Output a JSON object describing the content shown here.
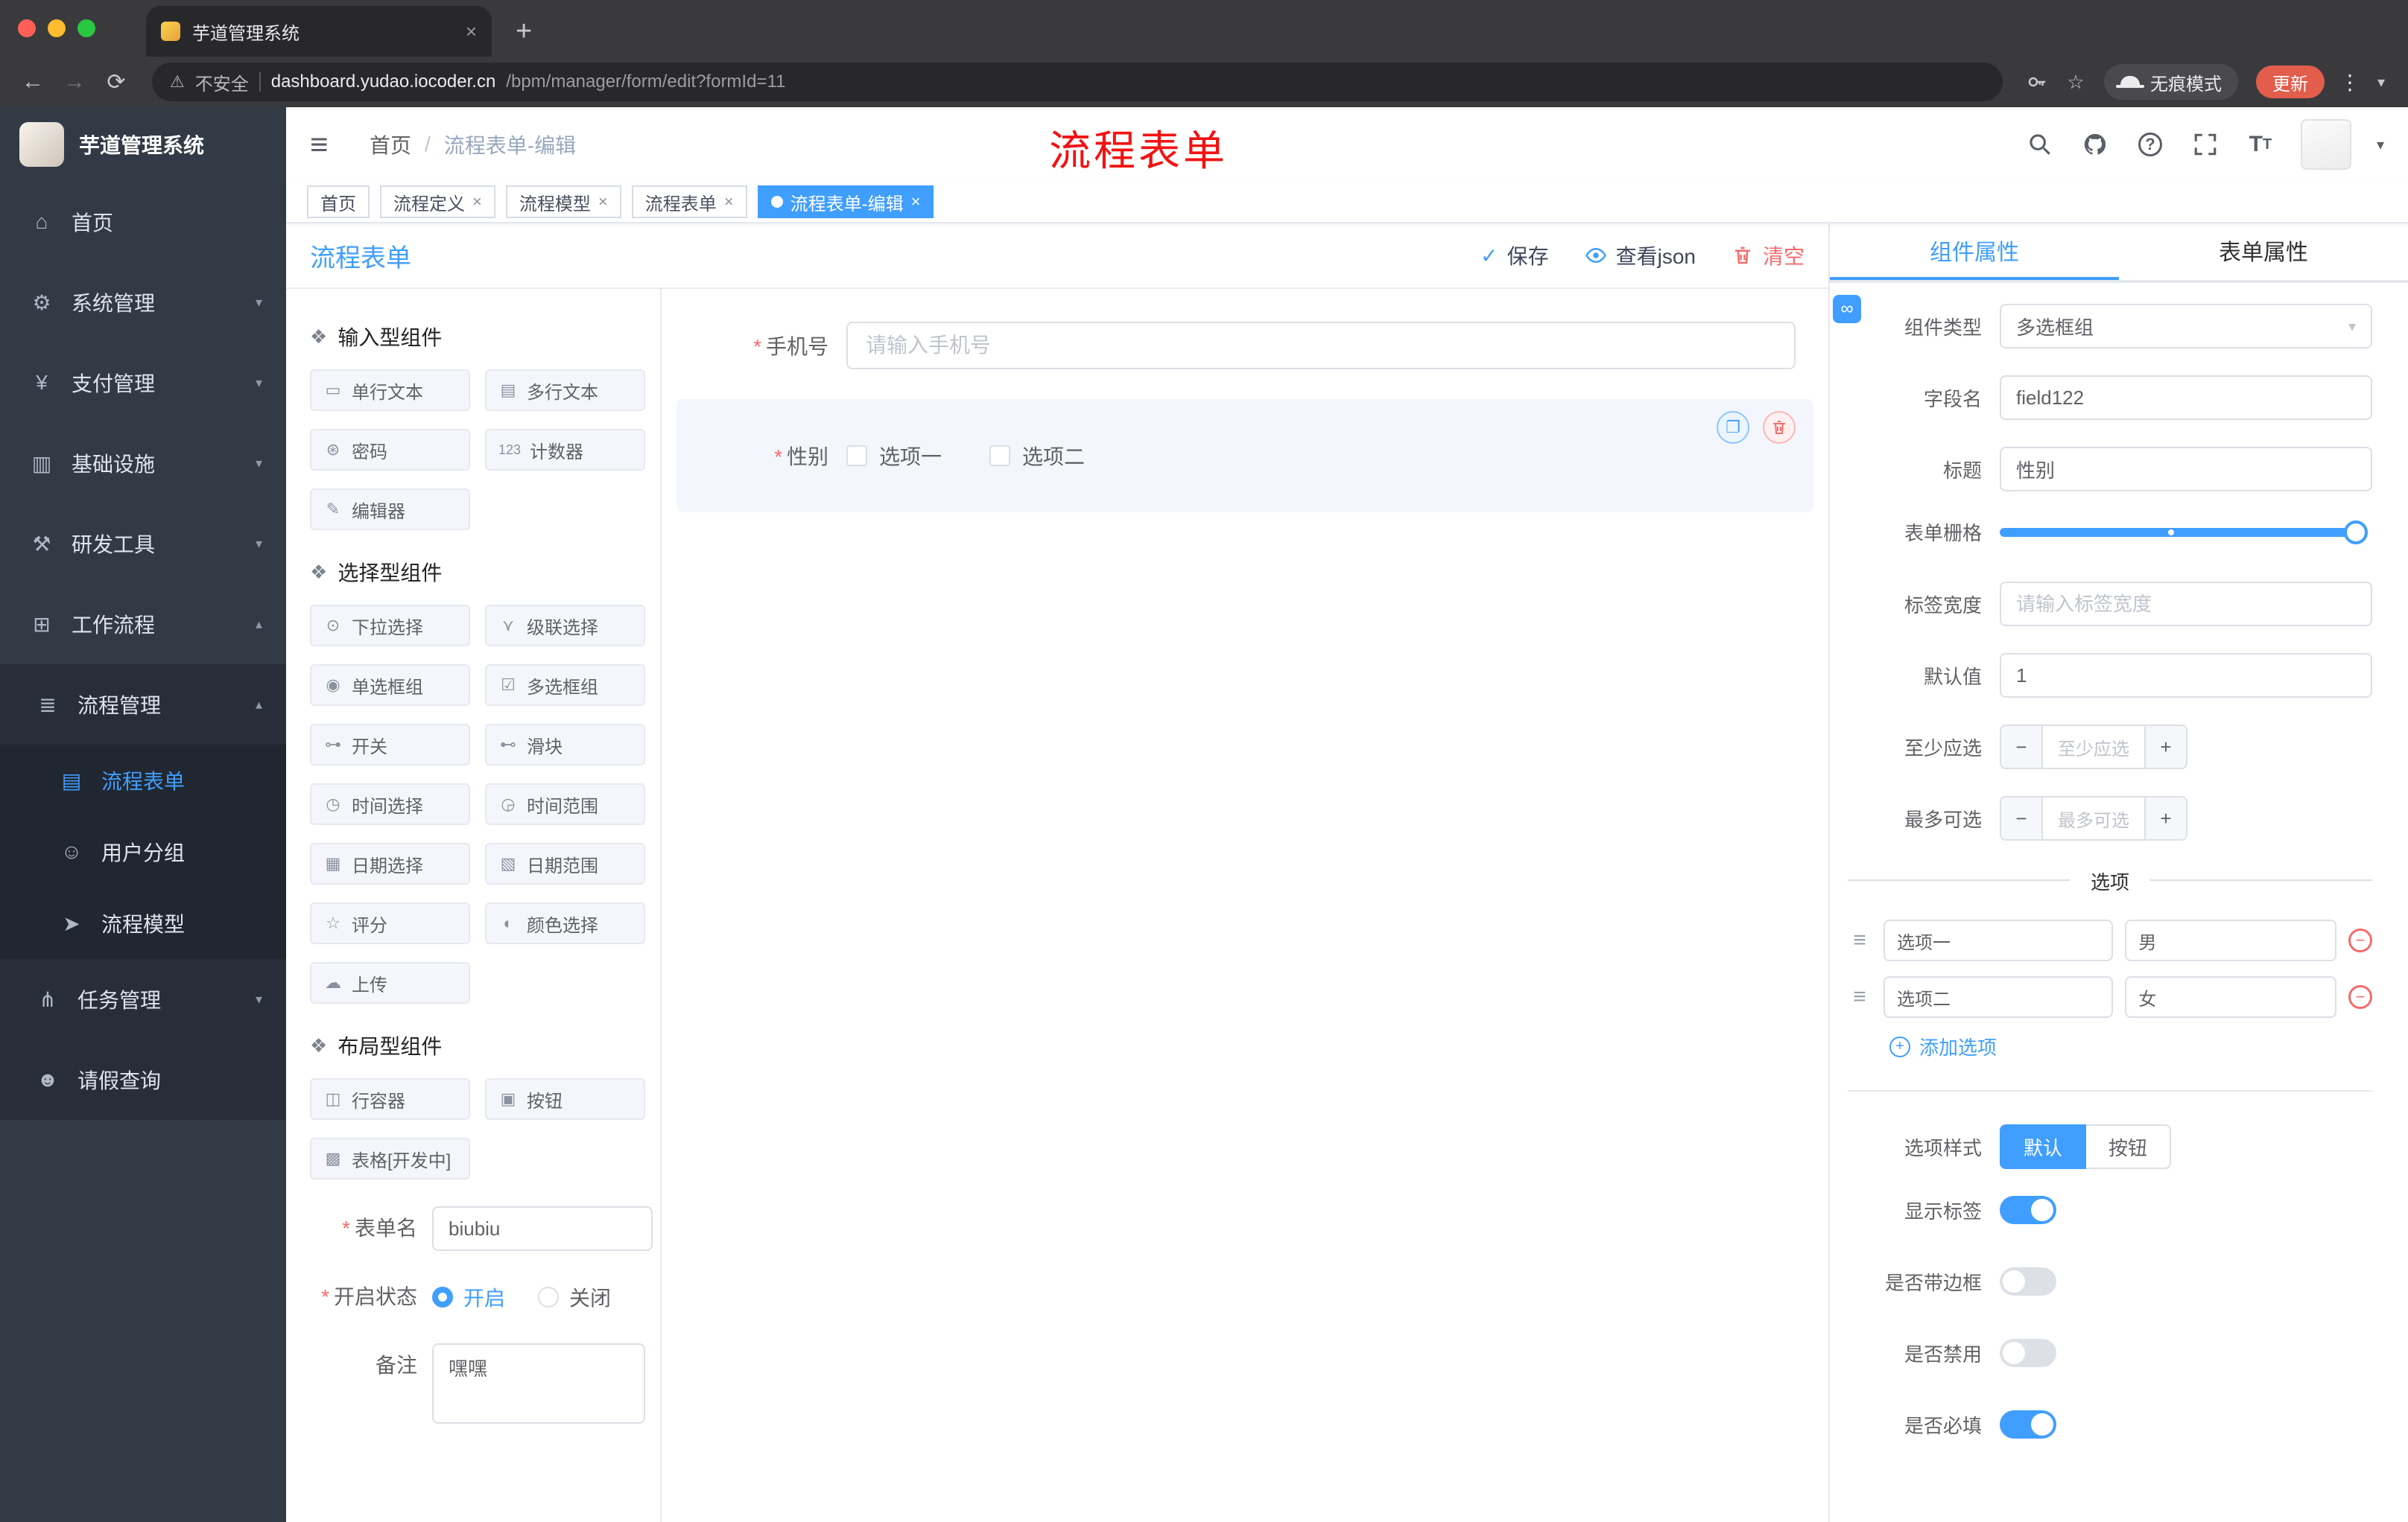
{
  "colors": {
    "accent": "#409eff",
    "danger": "#f56c6c",
    "watermark_red": "#f21212",
    "sidebar_bg": "#323a46"
  },
  "chrome": {
    "tab_title": "芋道管理系统",
    "security": "不安全",
    "url_host": "dashboard.yudao.iocoder.cn",
    "url_path": "/bpm/manager/form/edit?formId=11",
    "incognito": "无痕模式",
    "update": "更新"
  },
  "sidebar": {
    "title": "芋道管理系统",
    "items": [
      {
        "label": "首页",
        "icon": "home-icon",
        "glyph": "⌂"
      },
      {
        "label": "系统管理",
        "icon": "gear-icon",
        "glyph": "⚙"
      },
      {
        "label": "支付管理",
        "icon": "payment-icon",
        "glyph": "¥"
      },
      {
        "label": "基础设施",
        "icon": "infrastructure-icon",
        "glyph": "▥"
      },
      {
        "label": "研发工具",
        "icon": "dev-tools-icon",
        "glyph": "⚒"
      },
      {
        "label": "工作流程",
        "icon": "workflow-icon",
        "glyph": "⊞"
      }
    ],
    "process_group": {
      "label": "流程管理",
      "icon": "process-list-icon",
      "glyph": "≣"
    },
    "process_children": [
      {
        "label": "流程表单",
        "icon": "form-doc-icon",
        "glyph": "▤"
      },
      {
        "label": "用户分组",
        "icon": "user-group-icon",
        "glyph": "☺"
      },
      {
        "label": "流程模型",
        "icon": "send-icon",
        "glyph": "➤"
      }
    ],
    "task_group": {
      "label": "任务管理",
      "icon": "task-branch-icon",
      "glyph": "⋔"
    },
    "leave_item": {
      "label": "请假查询",
      "icon": "person-icon",
      "glyph": "☻"
    }
  },
  "header": {
    "breadcrumb": [
      "首页",
      "流程表单-编辑"
    ],
    "watermark": "流程表单"
  },
  "tags": [
    {
      "label": "首页"
    },
    {
      "label": "流程定义"
    },
    {
      "label": "流程模型"
    },
    {
      "label": "流程表单"
    },
    {
      "label": "流程表单-编辑"
    }
  ],
  "designer": {
    "title": "流程表单",
    "save": "保存",
    "view_json": "查看json",
    "clear": "清空",
    "groups": [
      {
        "title": "输入型组件",
        "items": [
          {
            "label": "单行文本",
            "icon": "text-field-icon",
            "glyph": "▭"
          },
          {
            "label": "多行文本",
            "icon": "textarea-icon",
            "glyph": "▤"
          },
          {
            "label": "密码",
            "icon": "password-icon",
            "glyph": "⊛"
          },
          {
            "label": "计数器",
            "icon": "counter-icon",
            "glyph": "123"
          },
          {
            "label": "编辑器",
            "icon": "editor-icon",
            "glyph": "✎"
          }
        ]
      },
      {
        "title": "选择型组件",
        "items": [
          {
            "label": "下拉选择",
            "icon": "select-icon",
            "glyph": "⊙"
          },
          {
            "label": "级联选择",
            "icon": "cascader-icon",
            "glyph": "⋎"
          },
          {
            "label": "单选框组",
            "icon": "radio-group-icon",
            "glyph": "◉"
          },
          {
            "label": "多选框组",
            "icon": "checkbox-group-icon",
            "glyph": "☑"
          },
          {
            "label": "开关",
            "icon": "switch-icon",
            "glyph": "⊶"
          },
          {
            "label": "滑块",
            "icon": "slider-icon",
            "glyph": "⊷"
          },
          {
            "label": "时间选择",
            "icon": "time-picker-icon",
            "glyph": "◷"
          },
          {
            "label": "时间范围",
            "icon": "time-range-icon",
            "glyph": "◶"
          },
          {
            "label": "日期选择",
            "icon": "date-picker-icon",
            "glyph": "▦"
          },
          {
            "label": "日期范围",
            "icon": "date-range-icon",
            "glyph": "▧"
          },
          {
            "label": "评分",
            "icon": "rate-icon",
            "glyph": "☆"
          },
          {
            "label": "颜色选择",
            "icon": "color-picker-icon",
            "glyph": "◐"
          },
          {
            "label": "上传",
            "icon": "upload-icon",
            "glyph": "☁"
          }
        ]
      },
      {
        "title": "布局型组件",
        "items": [
          {
            "label": "行容器",
            "icon": "row-container-icon",
            "glyph": "◫"
          },
          {
            "label": "按钮",
            "icon": "button-icon",
            "glyph": "▣"
          },
          {
            "label": "表格[开发中]",
            "icon": "table-icon",
            "glyph": "▩"
          }
        ]
      }
    ],
    "meta": {
      "form_name_label": "表单名",
      "form_name_value": "biubiu",
      "status_label": "开启状态",
      "status_on": "开启",
      "status_off": "关闭",
      "remark_label": "备注",
      "remark_value": "嘿嘿"
    },
    "canvas": {
      "phone_label": "手机号",
      "phone_placeholder": "请输入手机号",
      "gender_label": "性别",
      "gender_options": [
        "选项一",
        "选项二"
      ]
    }
  },
  "props": {
    "tabs": [
      "组件属性",
      "表单属性"
    ],
    "component_type_label": "组件类型",
    "component_type_value": "多选框组",
    "field_label": "字段名",
    "field_value": "field122",
    "title_label": "标题",
    "title_value": "性别",
    "grid_label": "表单栅格",
    "label_width_label": "标签宽度",
    "label_width_placeholder": "请输入标签宽度",
    "default_label": "默认值",
    "default_value": "1",
    "min_label": "至少应选",
    "min_placeholder": "至少应选",
    "max_label": "最多可选",
    "max_placeholder": "最多可选",
    "options_title": "选项",
    "options": [
      {
        "label": "选项一",
        "value": "男"
      },
      {
        "label": "选项二",
        "value": "女"
      }
    ],
    "add_option": "添加选项",
    "style_label": "选项样式",
    "style_default": "默认",
    "style_button": "按钮",
    "show_label_label": "显示标签",
    "border_label": "是否带边框",
    "disabled_label": "是否禁用",
    "required_label": "是否必填"
  }
}
